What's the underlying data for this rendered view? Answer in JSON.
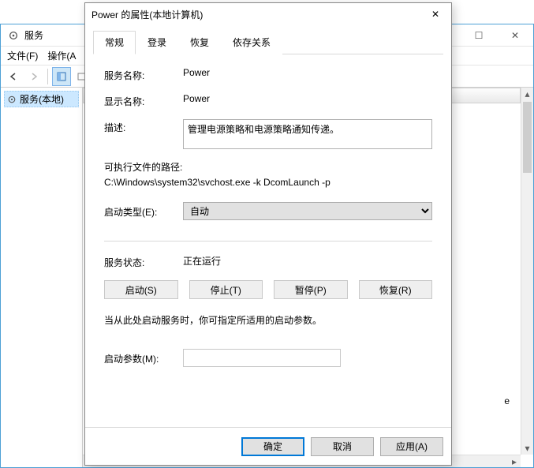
{
  "bg": {
    "title": "服务",
    "menus": [
      "文件(F)",
      "操作(A"
    ],
    "tree_node": "服务(本地)",
    "stray_char": "e"
  },
  "dialog": {
    "title": "Power 的属性(本地计算机)",
    "tabs": [
      "常规",
      "登录",
      "恢复",
      "依存关系"
    ],
    "labels": {
      "service_name": "服务名称:",
      "display_name": "显示名称:",
      "description": "描述:",
      "exe_path": "可执行文件的路径:",
      "startup_type": "启动类型(E):",
      "service_status": "服务状态:",
      "start_params": "启动参数(M):"
    },
    "values": {
      "service_name": "Power",
      "display_name": "Power",
      "description": "管理电源策略和电源策略通知传递。",
      "exe_path": "C:\\Windows\\system32\\svchost.exe -k DcomLaunch -p",
      "startup_type": "自动",
      "service_status": "正在运行"
    },
    "hint": "当从此处启动服务时，你可指定所适用的启动参数。",
    "state_buttons": [
      "启动(S)",
      "停止(T)",
      "暂停(P)",
      "恢复(R)"
    ],
    "footer_buttons": [
      "确定",
      "取消",
      "应用(A)"
    ]
  }
}
